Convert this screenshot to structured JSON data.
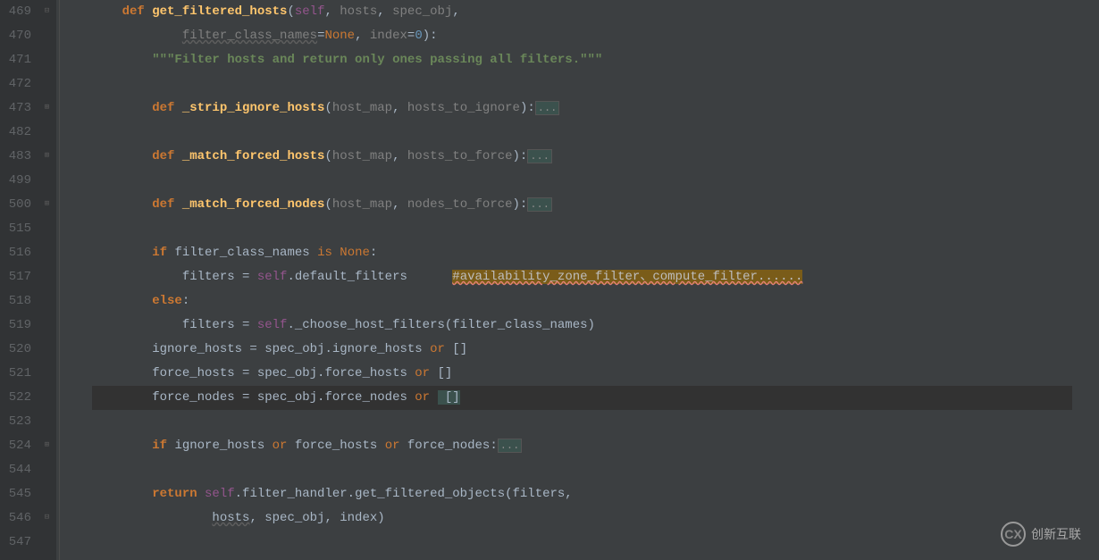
{
  "line_numbers": [
    "469",
    "470",
    "471",
    "472",
    "473",
    "482",
    "483",
    "499",
    "500",
    "515",
    "516",
    "517",
    "518",
    "519",
    "520",
    "521",
    "522",
    "523",
    "524",
    "544",
    "545",
    "546",
    "547"
  ],
  "current_line_number": "522",
  "code": {
    "l469": {
      "def": "def ",
      "fn": "get_filtered_hosts",
      "p_open": "(",
      "self": "self",
      "c1": ", ",
      "p1": "hosts",
      "c2": ", ",
      "p2": "spec_obj",
      "c3": ","
    },
    "l470": {
      "p1": "filter_class_names",
      "eq": "=",
      "none": "None",
      "c": ", ",
      "p2": "index",
      "eq2": "=",
      "num": "0",
      "close": "):"
    },
    "l471": {
      "doc": "\"\"\"Filter hosts and return only ones passing all filters.\"\"\""
    },
    "l473": {
      "def": "def ",
      "fn": "_strip_ignore_hosts",
      "open": "(",
      "p1": "host_map",
      "c": ", ",
      "p2": "hosts_to_ignore",
      "close": "):",
      "fold": "..."
    },
    "l483": {
      "def": "def ",
      "fn": "_match_forced_hosts",
      "open": "(",
      "p1": "host_map",
      "c": ", ",
      "p2": "hosts_to_force",
      "close": "):",
      "fold": "..."
    },
    "l500": {
      "def": "def ",
      "fn": "_match_forced_nodes",
      "open": "(",
      "p1": "host_map",
      "c": ", ",
      "p2": "nodes_to_force",
      "close": "):",
      "fold": "..."
    },
    "l516": {
      "if": "if ",
      "v": "filter_class_names ",
      "is": "is ",
      "none": "None",
      "colon": ":"
    },
    "l517": {
      "v": "filters = ",
      "self": "self",
      "dot": ".default_filters      ",
      "comment": "#availability_zone_filter、compute_filter......"
    },
    "l518": {
      "else": "else",
      "colon": ":"
    },
    "l519": {
      "v": "filters = ",
      "self": "self",
      "dot": "._choose_host_filters(filter_class_names)"
    },
    "l520": {
      "v": "ignore_hosts = spec_obj.ignore_hosts ",
      "or": "or",
      "br": " []"
    },
    "l521": {
      "v": "force_hosts = spec_obj.force_hosts ",
      "or": "or",
      "br": " []"
    },
    "l522": {
      "v": "force_nodes = spec_obj.force_nodes ",
      "or": "or",
      "br": " []"
    },
    "l524": {
      "if": "if ",
      "v1": "ignore_hosts ",
      "or1": "or",
      "v2": " force_hosts ",
      "or2": "or",
      "v3": " force_nodes:",
      "fold": "..."
    },
    "l545": {
      "ret": "return ",
      "self": "self",
      "rest": ".filter_handler.get_filtered_objects(filters,"
    },
    "l546": {
      "p1": "hosts",
      "c1": ", spec_obj, index)"
    }
  },
  "watermark": {
    "icon": "CX",
    "text": "创新互联"
  }
}
